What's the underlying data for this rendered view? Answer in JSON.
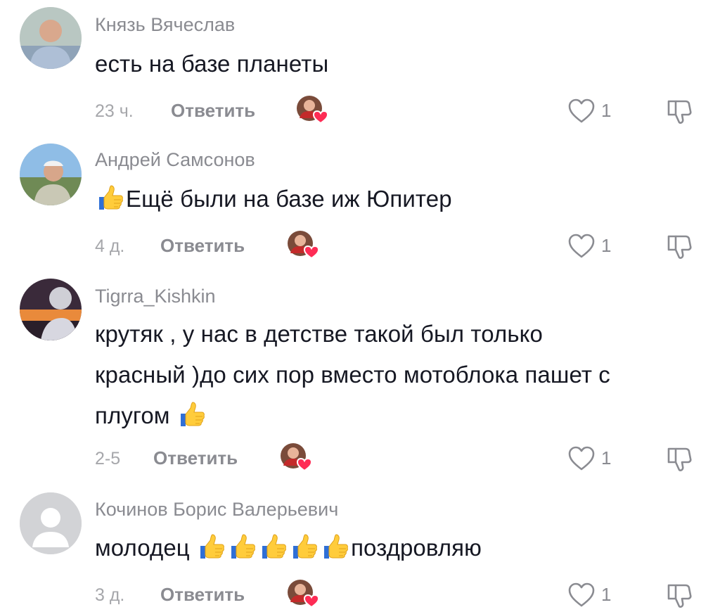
{
  "comments": [
    {
      "username": "Князь Вячеслав",
      "text": "есть на базе планеты",
      "time": "23 ч.",
      "reply_label": "Ответить",
      "likes": "1"
    },
    {
      "username": "Андрей Самсонов",
      "text": "Ещё были на базе иж Юпитер",
      "time": "4 д.",
      "reply_label": "Ответить",
      "likes": "1"
    },
    {
      "username": "Tigrra_Kishkin",
      "text_line1": "крутяк , у нас в детстве такой был только",
      "text_line2": "красный )до сих пор вместо мотоблока пашет с",
      "text_line3": "плугом",
      "time": "2-5",
      "reply_label": "Ответить",
      "likes": "1"
    },
    {
      "username": "Кочинов Борис Валерьевич",
      "text_prefix": "молодец",
      "text_suffix": "поздровляю",
      "time": "3 д.",
      "reply_label": "Ответить",
      "likes": "1"
    }
  ],
  "colors": {
    "username": "#8a8b91",
    "text": "#161823",
    "time": "#a6a7ab",
    "creator_heart": "#fe2c55"
  },
  "icons": {
    "like": "heart-outline-icon",
    "dislike": "thumbs-down-outline-icon",
    "creator_like": "creator-liked-heart-icon",
    "emoji": "thumbs-up-emoji"
  }
}
